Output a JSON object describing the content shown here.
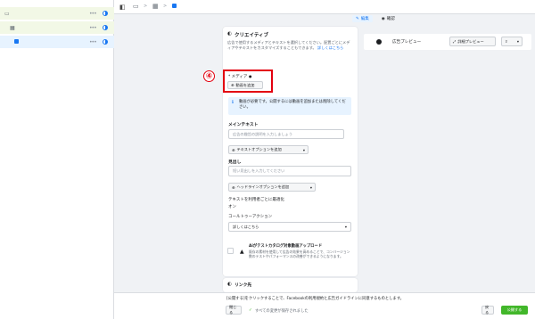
{
  "breadcrumb": {
    "sep": ">"
  },
  "sidebar": {
    "items": [
      {
        "dots": "•••"
      },
      {
        "dots": "•••"
      },
      {
        "dots": "•••"
      }
    ]
  },
  "tabs": {
    "edit": "編集",
    "preview": "確認"
  },
  "creative": {
    "title": "クリエイティブ",
    "description": "広告で使用するメディアとテキストを選択してください。配置ごとにメディアやテキストをカスタマイズすることもできます。",
    "learn_more": "詳しくはこちら",
    "media_label": "* メディア",
    "add_video": "動画を追加",
    "info_text": "動画が必要です。公開するには動画を追加または削除してください。",
    "main_text_label": "メインテキスト",
    "main_text_placeholder": "広告の趣旨の説明を入力しましょう",
    "add_text_option": "テキストオプションを追加",
    "headline_label": "見出し",
    "headline_placeholder": "短い見出しを入力してください",
    "add_headline_option": "ヘッドラインオプションを追加",
    "optimize_label": "テキストを利用者ごとに最適化",
    "optimize_value": "オン",
    "cta_label": "コールトゥーアクション",
    "cta_value": "詳しくはこちら",
    "catalog_title": "Aiがテストカタログ対象動画アップロード",
    "catalog_desc": "既存の素材を使用して広告の効果を高めることで、コンバージョン数のテストやパフォーマンスの改善ができるようになります。",
    "link_section": "リンク先",
    "step_number": "④"
  },
  "preview": {
    "ad_preview": "広告プレビュー",
    "detail_preview": "詳細プレビュー"
  },
  "footer": {
    "agreement": "[公開する]をクリックすることで、Facebookの利用規約と広告ガイドラインに同意するものとします。",
    "close": "閉じる",
    "saved": "すべての変更が保存されました",
    "back": "戻る",
    "publish": "公開する"
  },
  "colors": {
    "accent": "#1877f2",
    "highlight": "#e3000f",
    "publish": "#42b72a"
  }
}
